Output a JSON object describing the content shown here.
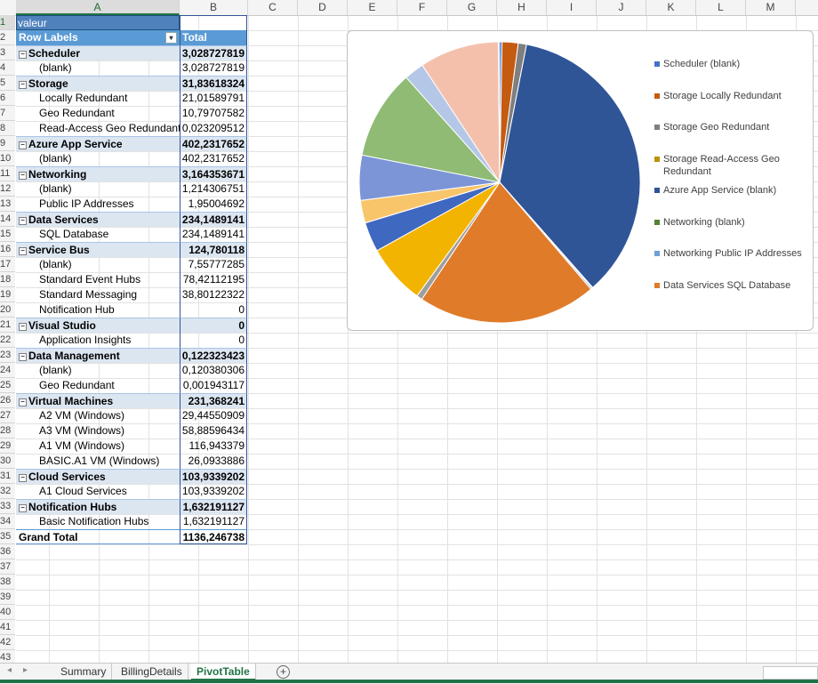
{
  "columns": [
    "A",
    "B",
    "C",
    "D",
    "E",
    "F",
    "G",
    "H",
    "I",
    "J",
    "K",
    "L",
    "M"
  ],
  "selected_column": "A",
  "selected_row": "1",
  "rows": [
    "1",
    "2",
    "3",
    "4",
    "5",
    "6",
    "7",
    "8",
    "9",
    "10",
    "11",
    "12",
    "13",
    "14",
    "15",
    "16",
    "17",
    "18",
    "19",
    "20",
    "21",
    "22",
    "23",
    "24",
    "25",
    "26",
    "27",
    "28",
    "29",
    "30",
    "31",
    "32",
    "33",
    "34",
    "35",
    "36",
    "37",
    "38",
    "39",
    "40",
    "41",
    "42",
    "43"
  ],
  "pivot": {
    "title_cell": "valeur",
    "row_labels_header": "Row Labels",
    "total_header": "Total",
    "lines": [
      {
        "label": "Scheduler",
        "value": "3,028727819",
        "type": "group"
      },
      {
        "label": "(blank)",
        "value": "3,028727819",
        "type": "item"
      },
      {
        "label": "Storage",
        "value": "31,83618324",
        "type": "group"
      },
      {
        "label": "Locally Redundant",
        "value": "21,01589791",
        "type": "item"
      },
      {
        "label": "Geo Redundant",
        "value": "10,79707582",
        "type": "item"
      },
      {
        "label": "Read-Access Geo Redundant",
        "value": "0,023209512",
        "type": "item"
      },
      {
        "label": "Azure App Service",
        "value": "402,2317652",
        "type": "group"
      },
      {
        "label": "(blank)",
        "value": "402,2317652",
        "type": "item"
      },
      {
        "label": "Networking",
        "value": "3,164353671",
        "type": "group"
      },
      {
        "label": "(blank)",
        "value": "1,214306751",
        "type": "item"
      },
      {
        "label": "Public IP Addresses",
        "value": "1,95004692",
        "type": "item"
      },
      {
        "label": "Data Services",
        "value": "234,1489141",
        "type": "group"
      },
      {
        "label": "SQL Database",
        "value": "234,1489141",
        "type": "item"
      },
      {
        "label": "Service Bus",
        "value": "124,780118",
        "type": "group"
      },
      {
        "label": "(blank)",
        "value": "7,55777285",
        "type": "item"
      },
      {
        "label": "Standard Event Hubs",
        "value": "78,42112195",
        "type": "item"
      },
      {
        "label": "Standard Messaging",
        "value": "38,80122322",
        "type": "item"
      },
      {
        "label": "Notification Hub",
        "value": "0",
        "type": "item"
      },
      {
        "label": "Visual Studio",
        "value": "0",
        "type": "group"
      },
      {
        "label": "Application Insights",
        "value": "0",
        "type": "item"
      },
      {
        "label": "Data Management",
        "value": "0,122323423",
        "type": "group"
      },
      {
        "label": "(blank)",
        "value": "0,120380306",
        "type": "item"
      },
      {
        "label": "Geo Redundant",
        "value": "0,001943117",
        "type": "item"
      },
      {
        "label": "Virtual Machines",
        "value": "231,368241",
        "type": "group"
      },
      {
        "label": "A2 VM (Windows)",
        "value": "29,44550909",
        "type": "item"
      },
      {
        "label": "A3 VM (Windows)",
        "value": "58,88596434",
        "type": "item"
      },
      {
        "label": "A1 VM (Windows)",
        "value": "116,943379",
        "type": "item"
      },
      {
        "label": "BASIC.A1 VM (Windows)",
        "value": "26,0933886",
        "type": "item"
      },
      {
        "label": "Cloud Services",
        "value": "103,9339202",
        "type": "group"
      },
      {
        "label": "A1 Cloud Services",
        "value": "103,9339202",
        "type": "item"
      },
      {
        "label": "Notification Hubs",
        "value": "1,632191127",
        "type": "group"
      },
      {
        "label": "Basic Notification Hubs",
        "value": "1,632191127",
        "type": "item"
      }
    ],
    "grand_total_label": "Grand Total",
    "grand_total_value": "1136,246738"
  },
  "chart_data": {
    "type": "pie",
    "title": "",
    "legend_position": "right",
    "legend_visible": [
      "Scheduler (blank)",
      "Storage Locally Redundant",
      "Storage Geo Redundant",
      "Storage Read-Access Geo Redundant",
      "Azure App Service (blank)",
      "Networking (blank)",
      "Networking Public IP Addresses",
      "Data Services SQL Database"
    ],
    "slices": [
      {
        "label": "Scheduler (blank)",
        "value": 3.028727819,
        "color": "#4472c4"
      },
      {
        "label": "Storage Locally Redundant",
        "value": 21.01589791,
        "color": "#c55a11"
      },
      {
        "label": "Storage Geo Redundant",
        "value": 10.79707582,
        "color": "#7f7f7f"
      },
      {
        "label": "Storage Read-Access Geo Redundant",
        "value": 0.023209512,
        "color": "#bf9000"
      },
      {
        "label": "Azure App Service (blank)",
        "value": 402.2317652,
        "color": "#2f5597"
      },
      {
        "label": "Networking (blank)",
        "value": 1.214306751,
        "color": "#548235"
      },
      {
        "label": "Networking Public IP Addresses",
        "value": 1.95004692,
        "color": "#6f9fd8"
      },
      {
        "label": "Data Services SQL Database",
        "value": 234.1489141,
        "color": "#e07b2a"
      },
      {
        "label": "Service Bus (blank)",
        "value": 7.55777285,
        "color": "#9e9e9e"
      },
      {
        "label": "Service Bus Standard Event Hubs",
        "value": 78.42112195,
        "color": "#f2b400"
      },
      {
        "label": "Service Bus Standard Messaging",
        "value": 38.80122322,
        "color": "#3f68c0"
      },
      {
        "label": "Service Bus Notification Hub",
        "value": 0,
        "color": "#70ad47"
      },
      {
        "label": "Visual Studio Application Insights",
        "value": 0,
        "color": "#264478"
      },
      {
        "label": "Data Management (blank)",
        "value": 0.120380306,
        "color": "#9e480e"
      },
      {
        "label": "Data Management Geo Redundant",
        "value": 0.001943117,
        "color": "#636363"
      },
      {
        "label": "Virtual Machines A2 VM (Windows)",
        "value": 29.44550909,
        "color": "#f9c56b"
      },
      {
        "label": "Virtual Machines A3 VM (Windows)",
        "value": 58.88596434,
        "color": "#7b95d6"
      },
      {
        "label": "Virtual Machines A1 VM (Windows)",
        "value": 116.943379,
        "color": "#8fbb74"
      },
      {
        "label": "Virtual Machines BASIC.A1 VM (Windows)",
        "value": 26.0933886,
        "color": "#b4c7e7"
      },
      {
        "label": "Cloud Services A1 Cloud Services",
        "value": 103.9339202,
        "color": "#f4c0ac"
      },
      {
        "label": "Notification Hubs Basic Notification Hubs",
        "value": 1.632191127,
        "color": "#5b9bd5"
      }
    ]
  },
  "sheet_tabs": [
    "Summary",
    "BillingDetails",
    "PivotTable"
  ],
  "active_tab": "PivotTable",
  "icons": {
    "prev": "◂",
    "next": "▸",
    "add": "+",
    "expand": "⊟",
    "dropdown": "▾"
  }
}
